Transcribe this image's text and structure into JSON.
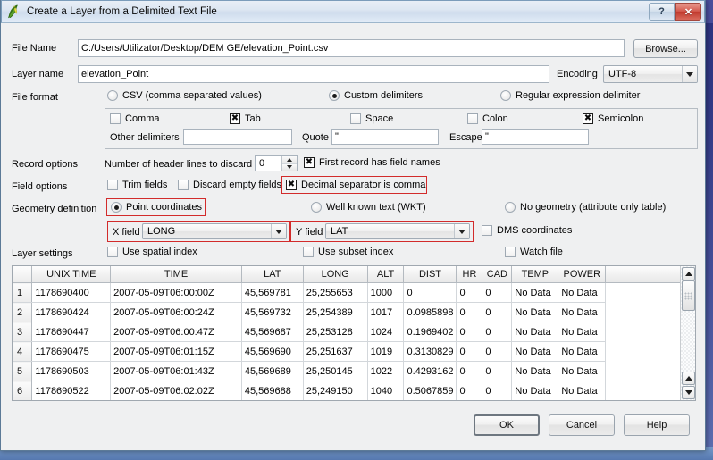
{
  "window": {
    "title": "Create a Layer from a Delimited Text File",
    "icon": "qgis-leaf-icon",
    "help_button": "?",
    "close_button": "✕"
  },
  "file_name": {
    "label": "File Name",
    "value": "C:/Users/Utilizator/Desktop/DEM GE/elevation_Point.csv",
    "browse_label": "Browse..."
  },
  "layer_name": {
    "label": "Layer name",
    "value": "elevation_Point",
    "encoding_label": "Encoding",
    "encoding_value": "UTF-8"
  },
  "file_format": {
    "label": "File format",
    "options": [
      {
        "label": "CSV (comma separated values)",
        "selected": false
      },
      {
        "label": "Custom delimiters",
        "selected": true
      },
      {
        "label": "Regular expression delimiter",
        "selected": false
      }
    ]
  },
  "delimiters": {
    "checks": [
      {
        "label": "Comma",
        "checked": false
      },
      {
        "label": "Tab",
        "checked": true
      },
      {
        "label": "Space",
        "checked": false
      },
      {
        "label": "Colon",
        "checked": false
      },
      {
        "label": "Semicolon",
        "checked": true
      }
    ],
    "other_label": "Other delimiters",
    "other_value": "",
    "quote_label": "Quote",
    "quote_value": "\"",
    "escape_label": "Escape",
    "escape_value": "\""
  },
  "record_options": {
    "label": "Record options",
    "header_lines_label": "Number of header lines to discard",
    "header_lines_value": "0",
    "first_record_label": "First record has field names",
    "first_record_checked": true
  },
  "field_options": {
    "label": "Field options",
    "trim_fields": {
      "label": "Trim fields",
      "checked": false
    },
    "discard_empty": {
      "label": "Discard empty fields",
      "checked": false
    },
    "decimal_comma": {
      "label": "Decimal separator is comma",
      "checked": true,
      "highlighted": true
    }
  },
  "geometry": {
    "label": "Geometry definition",
    "options": [
      {
        "label": "Point coordinates",
        "selected": true,
        "highlighted": true
      },
      {
        "label": "Well known text (WKT)",
        "selected": false,
        "highlighted": false
      },
      {
        "label": "No geometry (attribute only table)",
        "selected": false,
        "highlighted": false
      }
    ],
    "x_field_label": "X field",
    "x_field_value": "LONG",
    "y_field_label": "Y field",
    "y_field_value": "LAT",
    "dms_label": "DMS coordinates",
    "dms_checked": false
  },
  "layer_settings": {
    "label": "Layer settings",
    "spatial_index": {
      "label": "Use spatial index",
      "checked": false
    },
    "subset_index": {
      "label": "Use subset index",
      "checked": false
    },
    "watch_file": {
      "label": "Watch file",
      "checked": false
    }
  },
  "preview_table": {
    "columns": [
      "UNIX TIME",
      "TIME",
      "LAT",
      "LONG",
      "ALT",
      "DIST",
      "HR",
      "CAD",
      "TEMP",
      "POWER"
    ],
    "rows": [
      {
        "num": "1",
        "cells": [
          "1178690400",
          "2007-05-09T06:00:00Z",
          "45,569781",
          "25,255653",
          "1000",
          "0",
          "0",
          "0",
          "No Data",
          "No Data"
        ]
      },
      {
        "num": "2",
        "cells": [
          "1178690424",
          "2007-05-09T06:00:24Z",
          "45,569732",
          "25,254389",
          "1017",
          "0.0985898",
          "0",
          "0",
          "No Data",
          "No Data"
        ]
      },
      {
        "num": "3",
        "cells": [
          "1178690447",
          "2007-05-09T06:00:47Z",
          "45,569687",
          "25,253128",
          "1024",
          "0.1969402",
          "0",
          "0",
          "No Data",
          "No Data"
        ]
      },
      {
        "num": "4",
        "cells": [
          "1178690475",
          "2007-05-09T06:01:15Z",
          "45,569690",
          "25,251637",
          "1019",
          "0.3130829",
          "0",
          "0",
          "No Data",
          "No Data"
        ]
      },
      {
        "num": "5",
        "cells": [
          "1178690503",
          "2007-05-09T06:01:43Z",
          "45,569689",
          "25,250145",
          "1022",
          "0.4293162",
          "0",
          "0",
          "No Data",
          "No Data"
        ]
      },
      {
        "num": "6",
        "cells": [
          "1178690522",
          "2007-05-09T06:02:02Z",
          "45,569688",
          "25,249150",
          "1040",
          "0.5067859",
          "0",
          "0",
          "No Data",
          "No Data"
        ]
      }
    ]
  },
  "buttons": {
    "ok": "OK",
    "cancel": "Cancel",
    "help": "Help"
  },
  "colors": {
    "highlight": "#d22b2b",
    "titlebar_close": "#c0392c",
    "dialog_bg": "#eff0f1"
  }
}
